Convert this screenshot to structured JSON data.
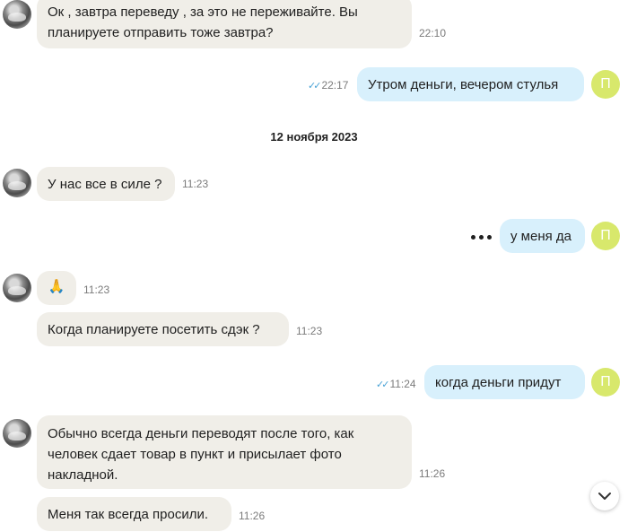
{
  "messages": {
    "m1": {
      "text_line1": "Ок , завтра переведу , за это не переживайте. Вы",
      "text_line2": "планируете отправить тоже завтра?",
      "time": "22:10"
    },
    "m2": {
      "text": "Утром деньги, вечером стулья",
      "time": "22:17"
    },
    "m3": {
      "text": "У нас все в силе ?",
      "time": "11:23"
    },
    "m4": {
      "text": "у меня да"
    },
    "m5": {
      "text": "🙏",
      "time": "11:23"
    },
    "m6": {
      "text": "Когда планируете посетить сдэк ?",
      "time": "11:23"
    },
    "m7": {
      "text": "когда деньги придут",
      "time": "11:24"
    },
    "m8": {
      "line1": "Обычно всегда деньги переводят после того, как",
      "line2": "человек сдает товар в пункт и присылает фото",
      "line3": "накладной.",
      "time": "11:26"
    },
    "m9": {
      "text": "Меня так всегда просили.",
      "time": "11:26"
    }
  },
  "date_separator": "12 ноября 2023",
  "me": {
    "avatar_letter": "П",
    "avatar_color": "#d8e86c"
  },
  "colors": {
    "incoming_bubble": "#f0eee8",
    "outgoing_bubble": "#d8f0fc",
    "read_ticks": "#4aa3d6"
  },
  "icons": {
    "read_receipt": "double-check-icon",
    "scroll_down": "chevron-down-icon"
  }
}
